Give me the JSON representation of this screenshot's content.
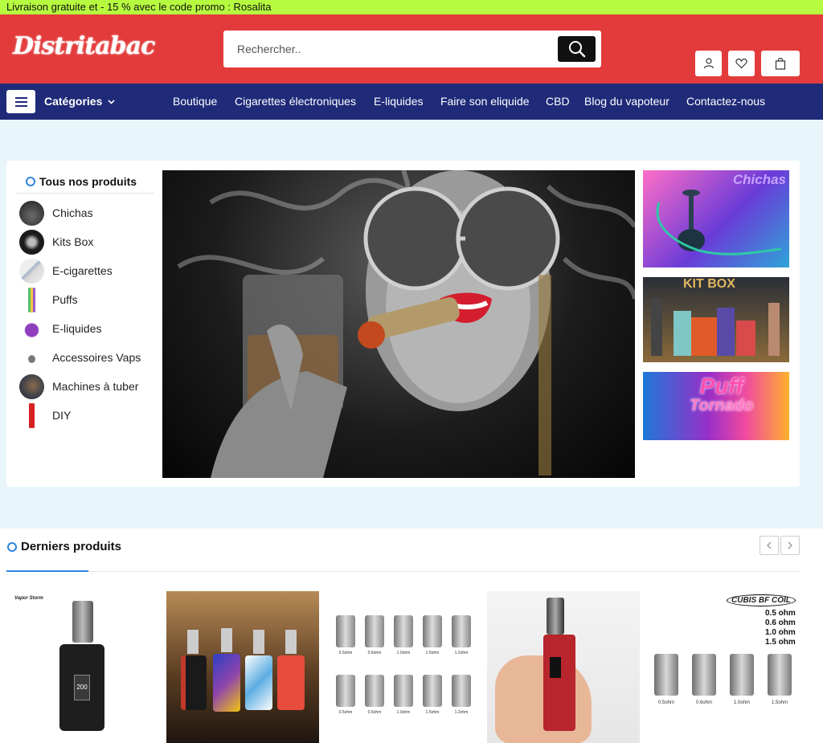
{
  "promo": {
    "text": "Livraison gratuite et - 15 % avec le code promo : Rosalita"
  },
  "header": {
    "logo": "Distritabac",
    "search_placeholder": "Rechercher..",
    "icons": [
      "search-icon",
      "user-icon",
      "heart-icon",
      "bag-icon"
    ]
  },
  "nav": {
    "categories_label": "Catégories",
    "links": [
      "Boutique",
      "Cigarettes électroniques",
      "E-liquides",
      "Faire son eliquide",
      "CBD",
      "Blog du vapoteur",
      "Contactez-nous"
    ]
  },
  "sidebar": {
    "title": "Tous nos produits",
    "items": [
      {
        "label": "Chichas"
      },
      {
        "label": "Kits Box"
      },
      {
        "label": "E-cigarettes"
      },
      {
        "label": "Puffs"
      },
      {
        "label": "E-liquides"
      },
      {
        "label": "Accessoires Vaps"
      },
      {
        "label": "Machines à tuber"
      },
      {
        "label": "DIY"
      }
    ]
  },
  "banners": {
    "chichas": "Chichas",
    "kitbox": "KIT BOX",
    "puff_line1": "Puff",
    "puff_line2": "Tornado"
  },
  "latest": {
    "title": "Derniers produits",
    "p1_brand": "Vapor Storm",
    "p1_screen": "200",
    "p3_labels": [
      "0.5ohm",
      "0.6ohm",
      "1.0ohm",
      "1.5ohm",
      "1.2ohm"
    ],
    "p5_title": "CUBIS BF COIL",
    "p5_specs": [
      "0.5 ohm",
      "0.6 ohm",
      "1.0 ohm",
      "1.5 ohm"
    ],
    "p5_labels": [
      "0.5ohm",
      "0.6ohm",
      "1.0ohm",
      "1.5ohm"
    ]
  },
  "colors": {
    "promo": "#b6fb3f",
    "header": "#e33b3b",
    "nav": "#1f2a78",
    "page_bg": "#e8f6fc",
    "accent": "#2e86de"
  }
}
